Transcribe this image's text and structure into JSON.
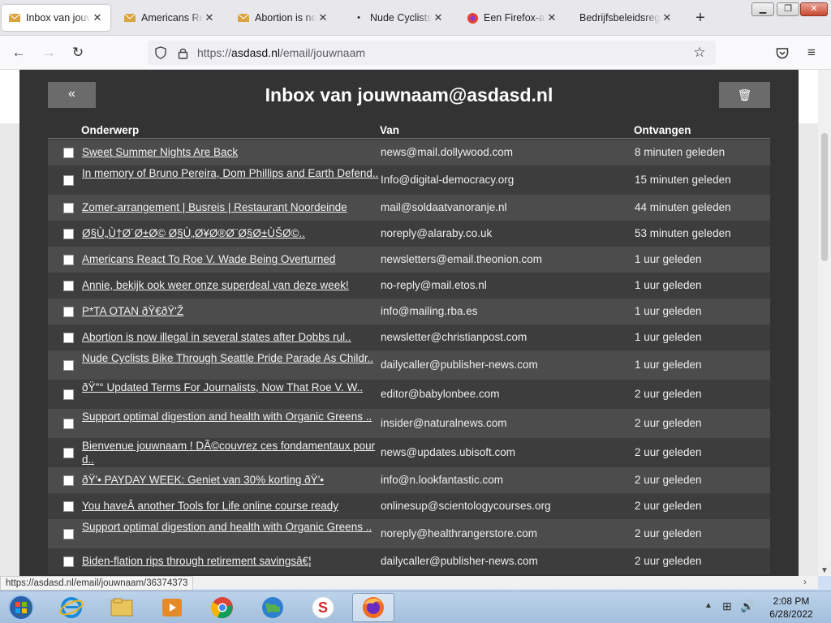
{
  "browser": {
    "tabs": [
      {
        "label": "Inbox van jouwnaam",
        "active": true
      },
      {
        "label": "Americans React To Roe"
      },
      {
        "label": "Abortion is now illegal"
      },
      {
        "label": "Nude Cyclists Bike"
      },
      {
        "label": "Een Firefox-account"
      },
      {
        "label": "Bedrijfsbeleidsregels"
      }
    ],
    "new_tab": "+",
    "url_prefix": "https://",
    "url_domain": "asdasd.nl",
    "url_path": "/email/jouwnaam",
    "status_url": "https://asdasd.nl/email/jouwnaam/36374373"
  },
  "page": {
    "title": "Inbox van jouwnaam@asdasd.nl",
    "back_label": "«",
    "trash_label": "🗑",
    "columns": {
      "subject": "Onderwerp",
      "from": "Van",
      "received": "Ontvangen"
    },
    "emails": [
      {
        "subject": "Sweet Summer Nights Are Back",
        "from": "news@mail.dollywood.com",
        "received": "8 minuten geleden"
      },
      {
        "subject": "In memory of Bruno Pereira, Dom Phillips and Earth Defend..",
        "from": "Info@digital-democracy.org",
        "received": "15 minuten geleden"
      },
      {
        "subject": "Zomer-arrangement | Busreis | Restaurant Noordeinde",
        "from": "mail@soldaatvanoranje.nl",
        "received": "44 minuten geleden"
      },
      {
        "subject": "Ø§Ù„Ù†Ø´Ø±Ø© Ø§Ù„Ø¥Ø®Ø¨Ø§Ø±ÙŠØ©..",
        "from": "noreply@alaraby.co.uk",
        "received": "53 minuten geleden"
      },
      {
        "subject": "Americans React To Roe V. Wade Being Overturned",
        "from": "newsletters@email.theonion.com",
        "received": "1 uur geleden"
      },
      {
        "subject": "Annie, bekijk ook weer onze superdeal van deze week!",
        "from": "no-reply@mail.etos.nl",
        "received": "1 uur geleden"
      },
      {
        "subject": "P*TA OTAN ðŸ€ðŸ'Ž",
        "from": "info@mailing.rba.es",
        "received": "1 uur geleden"
      },
      {
        "subject": "Abortion is now illegal in several states after Dobbs rul..",
        "from": "newsletter@christianpost.com",
        "received": "1 uur geleden"
      },
      {
        "subject": "Nude Cyclists Bike Through Seattle Pride Parade As Childr..",
        "from": "dailycaller@publisher-news.com",
        "received": "1 uur geleden"
      },
      {
        "subject": "ðŸ\"° Updated Terms For Journalists, Now That Roe V. W..",
        "from": "editor@babylonbee.com",
        "received": "2 uur geleden"
      },
      {
        "subject": "Support optimal digestion and health with Organic Greens ..",
        "from": "insider@naturalnews.com",
        "received": "2 uur geleden"
      },
      {
        "subject": "Bienvenue jouwnaam ! DÃ©couvrez ces fondamentaux pour d..",
        "from": "news@updates.ubisoft.com",
        "received": "2 uur geleden"
      },
      {
        "subject": "ðŸ'• PAYDAY WEEK: Geniet van 30% korting ðŸ'•",
        "from": "info@n.lookfantastic.com",
        "received": "2 uur geleden"
      },
      {
        "subject": "You haveÂ another Tools for Life online course ready",
        "from": "onlinesup@scientologycourses.org",
        "received": "2 uur geleden"
      },
      {
        "subject": "Support optimal digestion and health with Organic Greens ..",
        "from": "noreply@healthrangerstore.com",
        "received": "2 uur geleden"
      },
      {
        "subject": "Biden-flation rips through retirement savingsâ€¦",
        "from": "dailycaller@publisher-news.com",
        "received": "2 uur geleden"
      }
    ]
  },
  "taskbar": {
    "apps": [
      "start-orb",
      "internet-explorer",
      "file-explorer",
      "media-player",
      "chrome",
      "globe-app",
      "s-app",
      "firefox"
    ],
    "time": "2:08 PM",
    "date": "6/28/2022"
  }
}
